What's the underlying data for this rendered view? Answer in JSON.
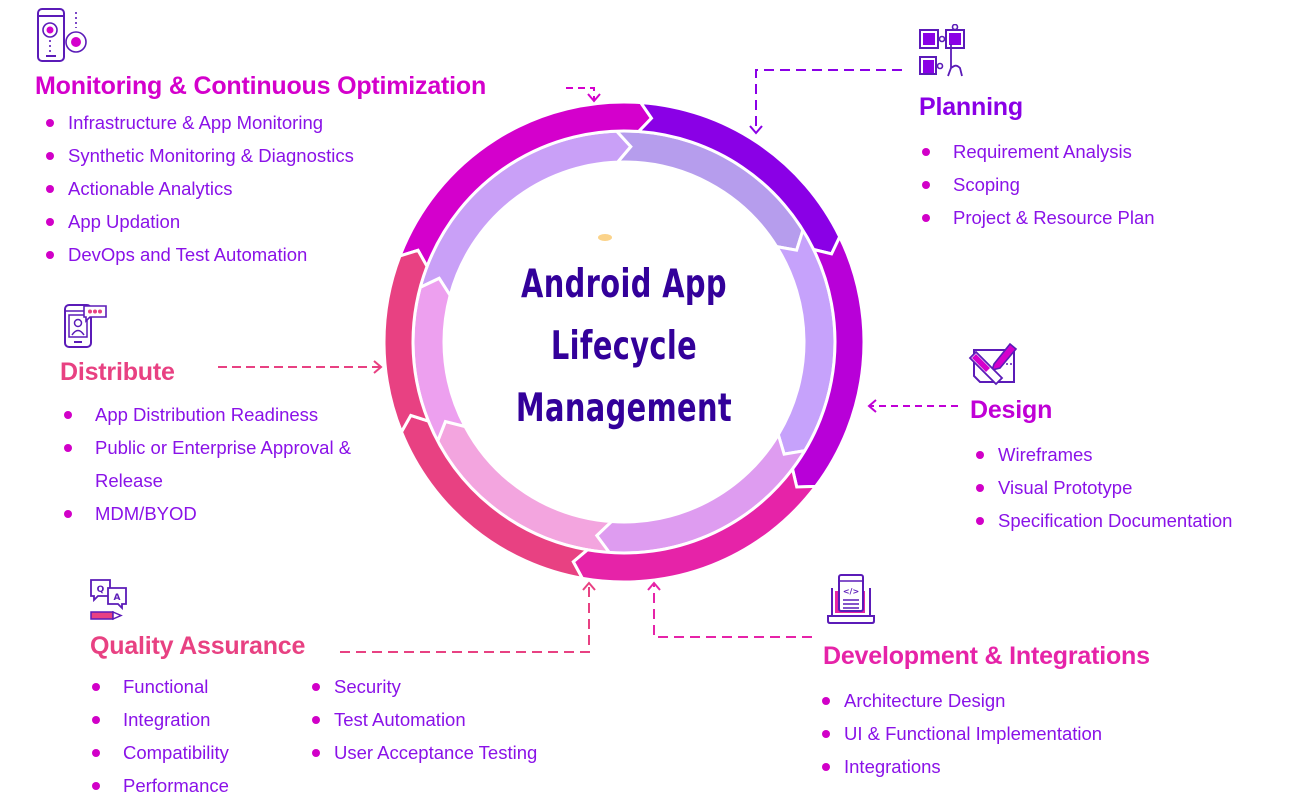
{
  "title": {
    "lines": [
      "Android App",
      "Lifecycle",
      "Management"
    ]
  },
  "colors": {
    "title": "#33009a",
    "bullet": "#d100c8",
    "item_text": "#8a12e8"
  },
  "stages": {
    "monitoring": {
      "heading": "Monitoring & Continuous Optimization",
      "icon": "phone-gears-icon",
      "color": "#d400cc",
      "items": [
        "Infrastructure & App Monitoring",
        "Synthetic Monitoring & Diagnostics",
        "Actionable Analytics",
        "App Updation",
        "DevOps and Test Automation"
      ]
    },
    "planning": {
      "heading": "Planning",
      "icon": "puzzle-hand-icon",
      "color": "#8a00e6",
      "items": [
        "Requirement Analysis",
        "Scoping",
        "Project & Resource Plan"
      ]
    },
    "design": {
      "heading": "Design",
      "icon": "pencil-ruler-icon",
      "color": "#b800d8",
      "items": [
        "Wireframes",
        "Visual Prototype",
        "Specification Documentation"
      ]
    },
    "development": {
      "heading": "Development & Integrations",
      "icon": "laptop-code-icon",
      "color": "#e620a8",
      "items": [
        "Architecture Design",
        "UI & Functional Implementation",
        "Integrations"
      ]
    },
    "quality": {
      "heading": "Quality Assurance",
      "icon": "qa-chat-pencil-icon",
      "color": "#e84080",
      "items_col1": [
        "Functional",
        "Integration",
        "Compatibility",
        "Performance"
      ],
      "items_col2": [
        "Security",
        "Test Automation",
        "User Acceptance Testing"
      ]
    },
    "distribute": {
      "heading": "Distribute",
      "icon": "phone-chat-icon",
      "color": "#e84080",
      "items": [
        "App Distribution Readiness",
        "Public or Enterprise Approval & Release",
        "MDM/BYOD"
      ],
      "item_lines": [
        "App Distribution Readiness",
        [
          "Public or Enterprise Approval &",
          "Release"
        ],
        "MDM/BYOD"
      ]
    }
  },
  "ring": {
    "segments": [
      {
        "stage": "monitoring",
        "outer": "#d400cc",
        "inner": "#c9a0f7"
      },
      {
        "stage": "planning",
        "outer": "#8a00e6",
        "inner": "#b69ded"
      },
      {
        "stage": "design",
        "outer": "#b800d8",
        "inner": "#c6a2fb"
      },
      {
        "stage": "development",
        "outer": "#e623a8",
        "inner": "#de9cf0"
      },
      {
        "stage": "quality",
        "outer": "#e84182",
        "inner": "#f3a5df"
      },
      {
        "stage": "distribute",
        "outer": "#e84182",
        "inner": "#eda0ef"
      }
    ]
  }
}
